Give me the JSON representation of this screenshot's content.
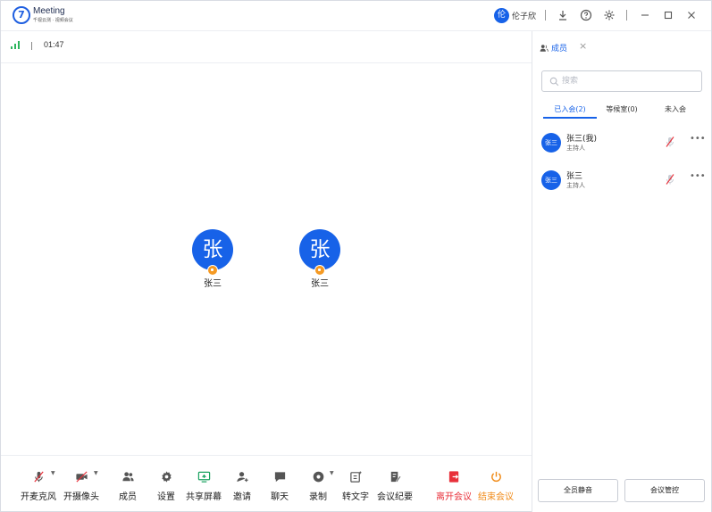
{
  "app": {
    "logo_char": "7",
    "title": "Meeting",
    "subtitle": "千视云测 · 视频会议",
    "user_initial": "伦",
    "user_name": "伦子欣"
  },
  "status": {
    "timer": "01:47"
  },
  "participants": [
    {
      "initial": "张",
      "name": "张三"
    },
    {
      "initial": "张",
      "name": "张三"
    }
  ],
  "toolbar": {
    "mic": "开麦克风",
    "camera": "开摄像头",
    "members": "成员",
    "settings": "设置",
    "share": "共享屏幕",
    "invite": "邀请",
    "chat": "聊天",
    "record": "录制",
    "transcribe": "转文字",
    "minutes": "会议纪要",
    "leave": "离开会议",
    "end": "结束会议"
  },
  "panel": {
    "tab_label": "成员",
    "search_placeholder": "搜索",
    "tabs": [
      "已入会(2)",
      "等候室(0)",
      "未入会"
    ],
    "members": [
      {
        "avatar": "张三",
        "name": "张三(我)",
        "role": "主持人"
      },
      {
        "avatar": "张三",
        "name": "张三",
        "role": "主持人"
      }
    ],
    "mute_all": "全员静音",
    "manage": "会议管控"
  },
  "colors": {
    "accent": "#1762e8",
    "leave": "#e8303a",
    "end": "#f08a17",
    "share": "#1aa260"
  }
}
